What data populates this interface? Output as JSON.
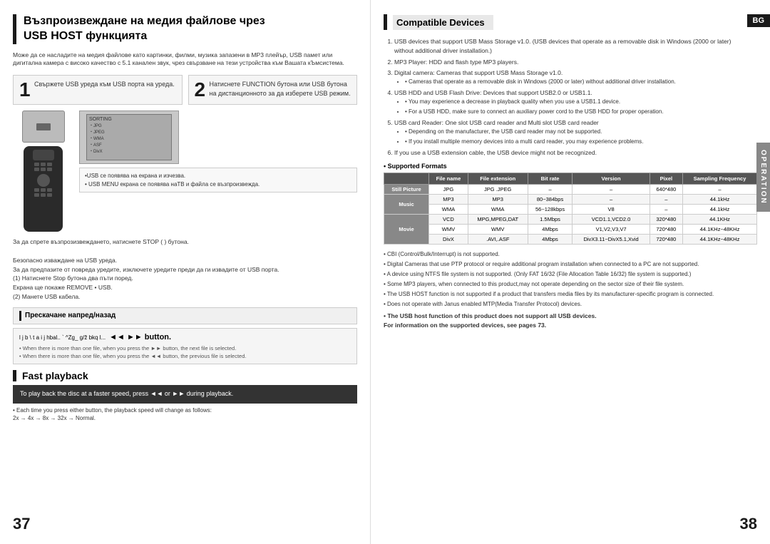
{
  "left_page": {
    "title_line1": "Възпроизвеждане на медия файлове чрез",
    "title_line2": "USB HOST функцията",
    "intro": "Може да се насладите на медия файлове като картинки, филми, музика запазени в MP3 плейър, USB памет или дигитална камера с високо качество с 5.1 канален звук, чрез свързване на тези устройства към Вашата кЪмсистема.",
    "step1_num": "1",
    "step1_text": "Свържете USB уреда към USB порта на уреда.",
    "step2_num": "2",
    "step2_text": "Натиснете FUNCTION бутона или USB бутона на дистанционното за да изберете USB режим.",
    "note1": "•USB  се появява на екрана и изчезва.\n• USB MENU екрана се появява наТВ и файла се възпроизвежда.",
    "stop_text": "За да спрете възпрозизвеждането, натиснете STOP ( ) бутона.\n\nБезопасно изваждане на USB уреда.\nЗа да предпазите от повреда уредите, изключете уредите преди да ги извадите от USB порта.\n(1) Натиснете Stop бутона два пъти поред.\nЕкрана ще покаже REMOVE • USB.\n(2) Манете USB кабела.",
    "skip_header": "Прескачане напред/назад",
    "skip_row_text": "l j b \\ t a i j h‌bal.. ` ^Zg_  g/ž bkq l...",
    "skip_button": "◄◄ ►► button.",
    "skip_note1": "• When there is more than one file, when you press the ►► button, the next file is selected.",
    "skip_note2": "• When there is more than one file, when you press the ◄◄ button, the previous file is selected.",
    "fast_title": "Fast playback",
    "fast_box": "To play back the disc at a faster speed, press ◄◄ or ►► during playback.",
    "fast_note": "• Each time you press either button, the playback speed will change as follows:\n2x → 4x → 8x → 32x → Normal.",
    "page_number": "37"
  },
  "right_page": {
    "compatible_title": "Compatible Devices",
    "items": [
      "USB devices that support USB Mass Storage v1.0. (USB devices that operate as a removable disk in Windows (2000 or later) without additional driver installation.)",
      "MP3 Player: HDD and flash type MP3 players.",
      "Digital camera: Cameras that support USB Mass Storage v1.0.",
      "USB HDD and USB Flash Drive: Devices that support USB2.0 or USB1.1.",
      "USB card Reader: One slot USB card reader and Multi slot USB card reader",
      "If you use a USB extension cable, the USB device might not be recognized."
    ],
    "item3_note": "• Cameras that operate as a removable disk in Windows (2000 or later) without additional driver installation.",
    "item4_note1": "• You may experience a decrease in playback quality when you use a USB1.1 device.",
    "item4_note2": "• For a USB HDD, make sure to connect an auxiliary power cord to the USB HDD for proper operation.",
    "item5_note1": "• Depending on the manufacturer, the USB card reader may not be supported.",
    "item5_note2": "• If you install multiple memory devices into a multi card reader, you may experience problems.",
    "supported_title": "• Supported Formats",
    "table": {
      "headers": [
        "",
        "File name",
        "File extension",
        "Bit rate",
        "Version",
        "Pixel",
        "Sampling Frequency"
      ],
      "rows": [
        [
          "Still Picture",
          "JPG",
          "JPG .JPEG",
          "–",
          "–",
          "640*480",
          "–"
        ],
        [
          "Music",
          "MP3",
          "MP3",
          "80~384bps",
          "–",
          "–",
          "44.1kHz"
        ],
        [
          "",
          "WMA",
          "WMA",
          "56~128kbps",
          "V8",
          "–",
          "44.1kHz"
        ],
        [
          "Movie",
          "VCD",
          "MPG,MPEG,DAT",
          "1.5Mbps",
          "VCD1.1,VCD2.0",
          "320*480",
          "44.1KHz"
        ],
        [
          "",
          "WMV",
          "WMV",
          "4Mbps",
          "V1,V2,V3,V7",
          "720*480",
          "44.1KHz~48KHz"
        ],
        [
          "",
          "DivX",
          ".AVI,.ASF",
          "4Mbps",
          "DivX3.11~DivX5.1,Xvid",
          "720*480",
          "44.1KHz~48KHz"
        ]
      ]
    },
    "bottom_notes": [
      "• CBI (Control/Bulk/Interrupt) is not supported.",
      "• Digital Cameras that use PTP protocol or require additional program installation when connected to a PC are not supported.",
      "• A device using NTFS file system is not supported. (Only FAT 16/32 (File Allocation Table 16/32) file system is supported.)",
      "• Some MP3 players, when connected to this product,may not operate depending on the sector size of their file system.",
      "• The USB HOST function is not supported if a product that transfers media files by its manufacturer-specific program is connected.",
      "• Does not operate with Janus enabled MTP(Media Transfer Protocol) devices."
    ],
    "bold_note1": "• The USB host function of this product does not support all USB devices.",
    "bold_note2": "For information on the supported devices, see pages 73.",
    "page_number": "38",
    "bg_label": "BG",
    "operation_label": "OPERATION"
  }
}
